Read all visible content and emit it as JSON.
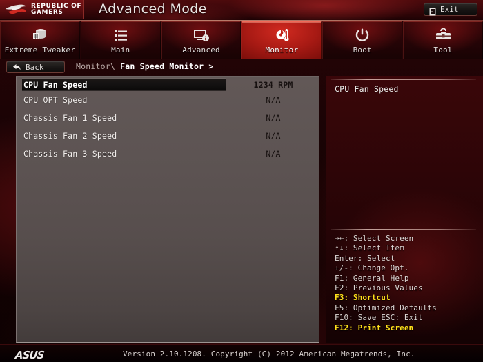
{
  "header": {
    "brand_line1": "REPUBLIC OF",
    "brand_line2": "GAMERS",
    "mode_title": "Advanced Mode",
    "exit_label": "Exit",
    "exit_icon": "exit-door-icon",
    "accent_red": "#c32318",
    "highlight_yellow": "#ffe11a"
  },
  "tabs": [
    {
      "label": "Extreme Tweaker",
      "icon": "tweaker-icon",
      "active": false
    },
    {
      "label": "Main",
      "icon": "list-icon",
      "active": false
    },
    {
      "label": "Advanced",
      "icon": "monitor-info-icon",
      "active": false
    },
    {
      "label": "Monitor",
      "icon": "fan-thermometer-icon",
      "active": true
    },
    {
      "label": "Boot",
      "icon": "power-icon",
      "active": false
    },
    {
      "label": "Tool",
      "icon": "toolbox-icon",
      "active": false
    }
  ],
  "navigation": {
    "back_label": "Back",
    "back_icon": "back-arrow-icon",
    "breadcrumb_parent": "Monitor\\",
    "breadcrumb_current": "Fan Speed Monitor >"
  },
  "settings": {
    "rows": [
      {
        "name": "CPU Fan Speed",
        "value": "1234 RPM",
        "selected": true
      },
      {
        "name": "CPU OPT Speed",
        "value": "N/A",
        "selected": false
      },
      {
        "name": "Chassis Fan 1 Speed",
        "value": "N/A",
        "selected": false
      },
      {
        "name": "Chassis Fan 2 Speed",
        "value": "N/A",
        "selected": false
      },
      {
        "name": "Chassis Fan 3 Speed",
        "value": "N/A",
        "selected": false
      }
    ]
  },
  "help": {
    "description": "CPU Fan Speed",
    "legend": [
      {
        "text": "→←: Select Screen",
        "highlight": false
      },
      {
        "text": "↑↓: Select Item",
        "highlight": false
      },
      {
        "text": "Enter: Select",
        "highlight": false
      },
      {
        "text": "+/-: Change Opt.",
        "highlight": false
      },
      {
        "text": "F1: General Help",
        "highlight": false
      },
      {
        "text": "F2: Previous Values",
        "highlight": false
      },
      {
        "text": "F3: Shortcut",
        "highlight": true
      },
      {
        "text": "F5: Optimized Defaults",
        "highlight": false
      },
      {
        "text": "F10: Save   ESC: Exit",
        "highlight": false
      },
      {
        "text": "F12: Print Screen",
        "highlight": true
      }
    ]
  },
  "footer": {
    "vendor_logo": "ASUS",
    "version_text": "Version 2.10.1208. Copyright (C) 2012 American Megatrends, Inc."
  }
}
